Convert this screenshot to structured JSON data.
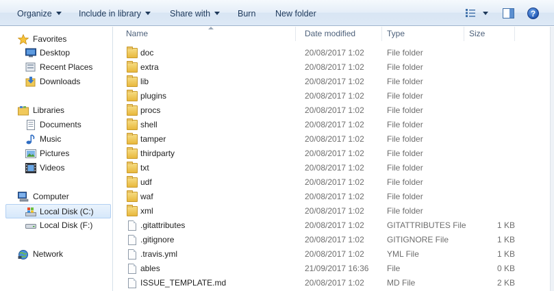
{
  "toolbar": {
    "organize": "Organize",
    "include_in_library": "Include in library",
    "share_with": "Share with",
    "burn": "Burn",
    "new_folder": "New folder",
    "help_glyph": "?"
  },
  "nav": {
    "items": [
      {
        "label": "Favorites",
        "icon": "star-icon"
      },
      {
        "label": "Desktop",
        "icon": "desktop-icon"
      },
      {
        "label": "Recent Places",
        "icon": "recent-places-icon"
      },
      {
        "label": "Downloads",
        "icon": "downloads-icon"
      },
      {
        "label": "Libraries",
        "icon": "libraries-icon"
      },
      {
        "label": "Documents",
        "icon": "documents-icon"
      },
      {
        "label": "Music",
        "icon": "music-icon"
      },
      {
        "label": "Pictures",
        "icon": "pictures-icon"
      },
      {
        "label": "Videos",
        "icon": "videos-icon"
      },
      {
        "label": "Computer",
        "icon": "computer-icon"
      },
      {
        "label": "Local Disk (C:)",
        "icon": "local-disk-icon"
      },
      {
        "label": "Local Disk (F:)",
        "icon": "drive-icon"
      },
      {
        "label": "Network",
        "icon": "network-icon"
      }
    ],
    "selected": "Local Disk (C:)"
  },
  "columns": {
    "name": "Name",
    "date_modified": "Date modified",
    "type": "Type",
    "size": "Size"
  },
  "files": [
    {
      "name": "doc",
      "date": "20/08/2017 1:02",
      "type": "File folder",
      "size": "",
      "kind": "folder"
    },
    {
      "name": "extra",
      "date": "20/08/2017 1:02",
      "type": "File folder",
      "size": "",
      "kind": "folder"
    },
    {
      "name": "lib",
      "date": "20/08/2017 1:02",
      "type": "File folder",
      "size": "",
      "kind": "folder"
    },
    {
      "name": "plugins",
      "date": "20/08/2017 1:02",
      "type": "File folder",
      "size": "",
      "kind": "folder"
    },
    {
      "name": "procs",
      "date": "20/08/2017 1:02",
      "type": "File folder",
      "size": "",
      "kind": "folder"
    },
    {
      "name": "shell",
      "date": "20/08/2017 1:02",
      "type": "File folder",
      "size": "",
      "kind": "folder"
    },
    {
      "name": "tamper",
      "date": "20/08/2017 1:02",
      "type": "File folder",
      "size": "",
      "kind": "folder"
    },
    {
      "name": "thirdparty",
      "date": "20/08/2017 1:02",
      "type": "File folder",
      "size": "",
      "kind": "folder"
    },
    {
      "name": "txt",
      "date": "20/08/2017 1:02",
      "type": "File folder",
      "size": "",
      "kind": "folder"
    },
    {
      "name": "udf",
      "date": "20/08/2017 1:02",
      "type": "File folder",
      "size": "",
      "kind": "folder"
    },
    {
      "name": "waf",
      "date": "20/08/2017 1:02",
      "type": "File folder",
      "size": "",
      "kind": "folder"
    },
    {
      "name": "xml",
      "date": "20/08/2017 1:02",
      "type": "File folder",
      "size": "",
      "kind": "folder"
    },
    {
      "name": ".gitattributes",
      "date": "20/08/2017 1:02",
      "type": "GITATTRIBUTES File",
      "size": "1 KB",
      "kind": "file"
    },
    {
      "name": ".gitignore",
      "date": "20/08/2017 1:02",
      "type": "GITIGNORE File",
      "size": "1 KB",
      "kind": "file"
    },
    {
      "name": ".travis.yml",
      "date": "20/08/2017 1:02",
      "type": "YML File",
      "size": "1 KB",
      "kind": "file"
    },
    {
      "name": "ables",
      "date": "21/09/2017 16:36",
      "type": "File",
      "size": "0 KB",
      "kind": "file"
    },
    {
      "name": "ISSUE_TEMPLATE.md",
      "date": "20/08/2017 1:02",
      "type": "MD File",
      "size": "2 KB",
      "kind": "file"
    }
  ]
}
